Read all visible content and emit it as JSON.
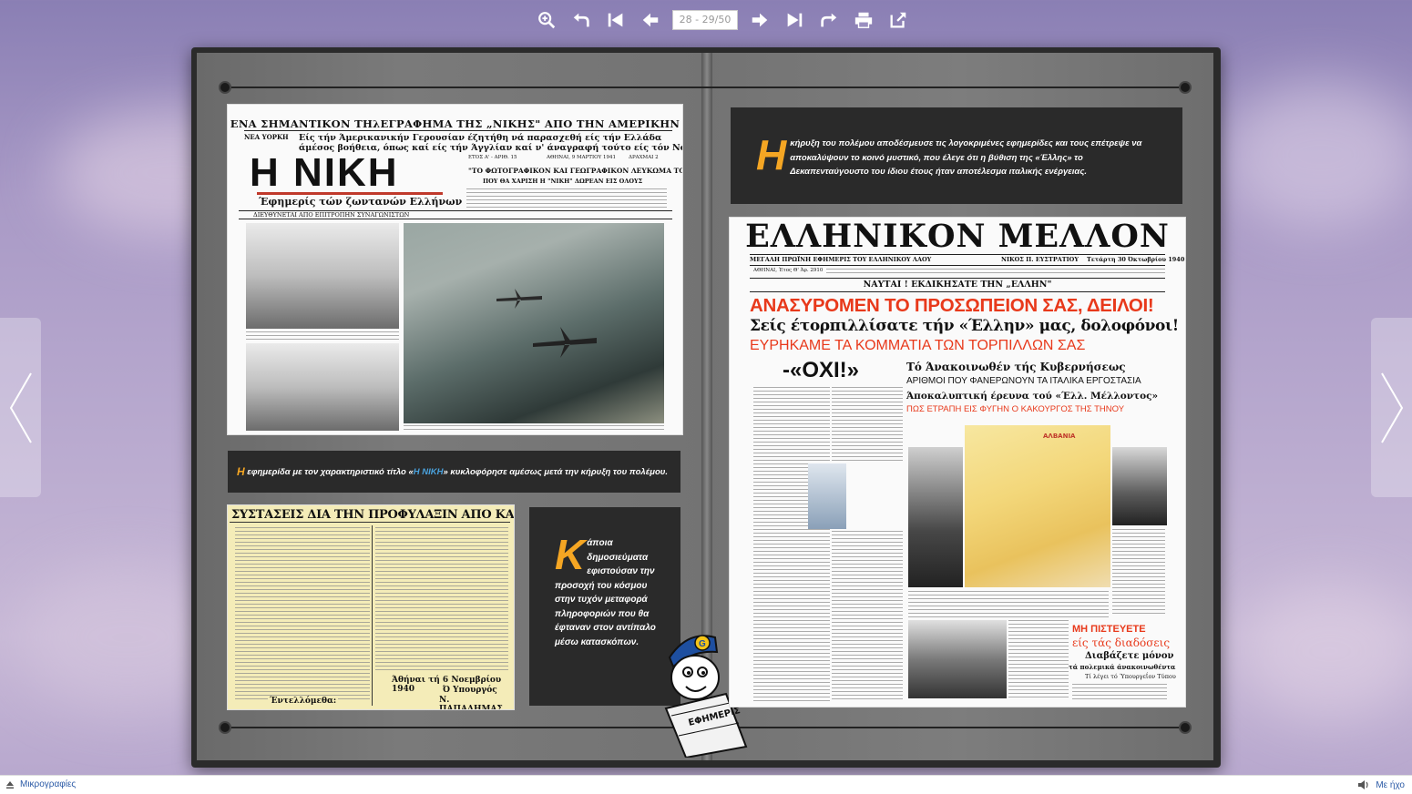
{
  "toolbar": {
    "page_field_value": "28 - 29/50",
    "buttons": [
      "zoom-in",
      "undo",
      "first-page",
      "previous-page",
      "next-page",
      "last-page",
      "redo",
      "print",
      "share"
    ]
  },
  "left_page": {
    "niki": {
      "headline_top": "ΕΝΑ ΣΗΜΑΝΤΙΚΟΝ ΤΗλΕΓΡΑΦΗΜΑ ΤΗΣ „ΝΙΚΗΣ\" ΑΠΟ ΤΗΝ ΑΜΕΡΙΚΗΝ",
      "dateline": "ΝΕΑ ΥΟΡΚΗ",
      "lead_line1": "Είς τήν Άμερικανικήν Γερουσίαν έζητήθη νά παρασχεθή είς τήν Ελλάδα",
      "lead_line2": "άμέσος βοήθεια, όπως καί είς τήν Άγγλίαν καί ν' άναγραφή τούτο είς τόν Νόμον",
      "masthead": "Η ΝΙΚΗ",
      "tagline": "Έφημερίς τών ζωντανών Ελλήνων",
      "sub_tagline": "ΔΙΕΥΘΥΝΕΤΑΙ ΑΠΟ ΕΠΙΤΡΟΠΗΝ ΣΥΝΑΓΩΝΙΣΤΩΝ",
      "album_title": "\"ΤΟ ΦΩΤΟΓΡΑΦΙΚΟΝ ΚΑΙ ΓΕΩΓΡΑΦΙΚΟΝ ΛΕΥΚΩΜΑ ΤΟΥ ΠΟΛΕΜΟΥ\"",
      "album_sub": "ΠΟΥ ΘΑ ΧΑΡΙΣΗ Η \"ΝΙΚΗ\" ΔΩΡΕΑΝ ΕΙΣ ΟΛΟΥΣ",
      "issue_line": "ΕΤΟΣ Α' - ΑΡΙΘ. 15",
      "date_line": "ΑΘΗΝΑΙ, 9 ΜΑΡΤΙΟΥ 1941",
      "price_line": "ΔΡΑΧΜΑΙ 2"
    },
    "caption1": {
      "initial": "Η",
      "text_before": " εφημερίδα με τον χαρακτηριστικό τίτλο «",
      "highlight": "Η ΝΙΚΗ",
      "text_after": "» κυκλοφόρησε αμέσως μετά την κήρυξη του πολέμου."
    },
    "clipping": {
      "title": "ΣΥΣΤΑΣΕΙΣ ΔΙΑ ΤΗΝ ΠΡΟΦΥΛΑΞΙΝ ΑΠΟ ΚΑΤΑΣΚΟΠΟΥΣ",
      "signature_date": "Άθήναι τή 6 Νοεμβρίου 1940",
      "signature_role": "Ό Υπουργός",
      "signature_name": "Ν. ΠΑΠΑΔΗΜΑΣ",
      "closing": "Έντελλόμεθα:"
    },
    "caption2": {
      "initial": "Κ",
      "text": "άποια δημοσιεύματα εφιστούσαν την προσοχή του κόσμου στην τυχόν μεταφορά πληροφοριών που θα έφταναν στον αντίπαλο μέσω κατασκόπων."
    },
    "mascot_label": "ΕΦΗΜΕΡΙΣ"
  },
  "right_page": {
    "caption": {
      "initial": "Η",
      "text": " κήρυξη του πολέμου απoδέσμευσε τις λογοκριμένες εφημερίδες και τους επέτρεψε να αποκαλύψουν το κοινό μυστικό, που έλεγε ότι η βύθιση της «Έλλης» το Δεκαπενταύγουστο του ίδιου έτους ήταν αποτέλεσμα ιταλικής ενέργειας."
    },
    "mellon": {
      "masthead": "ΕΛΛΗΝΙΚΟΝ ΜΕΛΛΟΝ",
      "subline": "ΜΕΓΑΛΗ ΠΡΩΪΝΗ ΕΦΗΜΕΡΙΣ ΤΟΥ ΕΛΛΗΝΙΚΟΥ ΛΑΟΥ",
      "editor": "ΝΙΚΟΣ Π. ΕΥΣΤΡΑΤΙΟΥ",
      "date": "Τετάρτη 30 Όκτωβρίου 1940",
      "issue": "ΑΘΗΝΑΙ, Έτος Θ' Άρ. 2910",
      "banner": "ΝΑΥΤΑΙ ! ΕΚΔΙΚΗΣΑΤΕ ΤΗΝ „ΕΛΛΗΝ\"",
      "headline1": "ΑΝΑΣΥΡΟΜΕΝ ΤΟ ΠΡΟΣΩΠΕΙΟΝ ΣΑΣ, ΔΕΙΛΟΙ!",
      "headline2": "Σείς έτορπιλλίσατε τήν «Έλλην» μας, δολοφόνοι!",
      "headline3": "ΕΥΡΗΚΑΜΕ ΤΑ ΚΟΜΜΑΤΙΑ ΤΩΝ ΤΟΡΠΙΛΛΩΝ ΣΑΣ",
      "oxi": "-«ΟΧΙ!»",
      "announce1": "Τό Άνακοινωθέν τής Κυβερνήσεως",
      "announce2": "ΑΡΙΘΜΟΙ ΠΟΥ ΦΑΝΕΡΩΝΟΥΝ ΤΑ ΙΤΑΛΙΚΑ ΕΡΓΟΣΤΑΣΙΑ",
      "announce3": "Άποκαλυπτική έρευνα τού «Έλλ. Μέλλοντος»",
      "announce4": "ΠΩΣ ΕΤΡΑΠΗ ΕΙΣ ΦΥΓΗΝ Ο ΚΑΚΟΥΡΓΟΣ ΤΗΣ ΤΗΝΟΥ",
      "map_label": "ΑΛΒΑΝΙΑ",
      "dont_believe1": "ΜΗ ΠΙΣΤΕΥΕΤΕ",
      "dont_believe2": "είς τάς διαδόσεις",
      "dont_believe3": "Διαβάζετε μόνον",
      "dont_believe4": "τά πολεμικά άνακοινωθέντα",
      "dont_believe5": "Τί λέγει τό Ύπουργεΐον Τύπου"
    }
  },
  "bottombar": {
    "thumbnails_label": "Μικρογραφίες",
    "sound_label": "Με ήχο"
  }
}
